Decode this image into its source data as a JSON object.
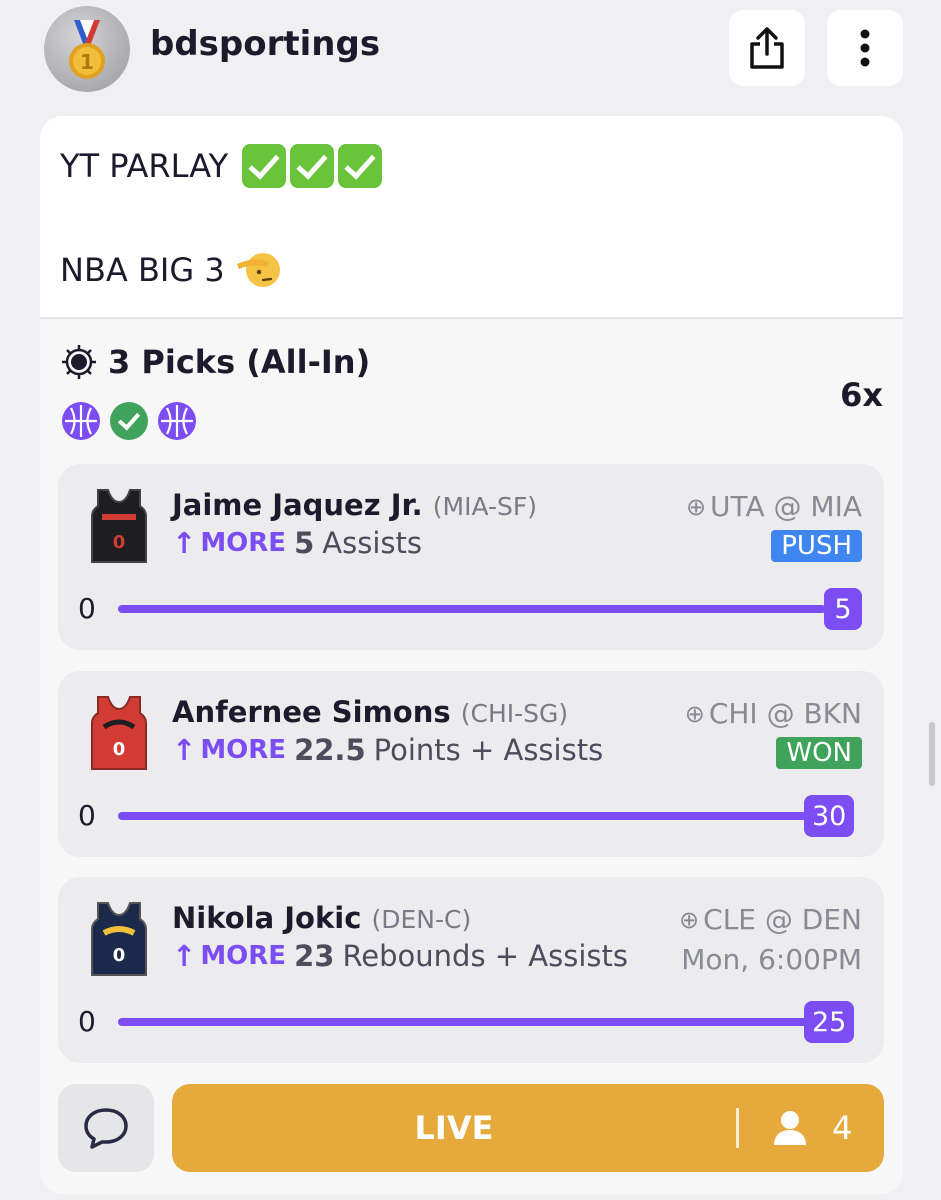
{
  "header": {
    "username": "bdsportings",
    "avatar_icon": "first-place-medal-icon",
    "share_icon": "share-icon",
    "more_icon": "more-vertical-icon"
  },
  "post": {
    "line1": "YT PARLAY",
    "line2": "NBA BIG 3",
    "line1_emoji_icons": [
      "check-box-icon",
      "check-box-icon",
      "check-box-icon"
    ],
    "line2_emoji_icon": "saluting-face-icon"
  },
  "entry": {
    "title": "3 Picks (All-In)",
    "multiplier": "6x",
    "status_icons": [
      "basketball-icon",
      "check-circle-icon",
      "basketball-icon"
    ]
  },
  "picks": [
    {
      "player": "Jaime Jaquez Jr.",
      "position": "(MIA-SF)",
      "direction": "MORE",
      "line": "5",
      "stat": "Assists",
      "matchup": "UTA @ MIA",
      "result": "PUSH",
      "progress_start": "0",
      "progress_value": "5",
      "jersey_color": "#1e1e22"
    },
    {
      "player": "Anfernee Simons",
      "position": "(CHI-SG)",
      "direction": "MORE",
      "line": "22.5",
      "stat": "Points + Assists",
      "matchup": "CHI @ BKN",
      "result": "WON",
      "progress_start": "0",
      "progress_value": "30",
      "jersey_color": "#d23c34"
    },
    {
      "player": "Nikola Jokic",
      "position": "(DEN-C)",
      "direction": "MORE",
      "line": "23",
      "stat": "Rebounds + Assists",
      "matchup": "CLE @ DEN",
      "game_time": "Mon, 6:00PM",
      "progress_start": "0",
      "progress_value": "25",
      "jersey_color": "#1b2a4a"
    }
  ],
  "footer": {
    "chat_icon": "chat-bubble-icon",
    "live_label": "LIVE",
    "viewer_icon": "person-icon",
    "viewer_count": "4"
  },
  "colors": {
    "accent": "#7b4df2",
    "live": "#e5a93c",
    "push": "#3f86f0",
    "won": "#3fa35b"
  }
}
